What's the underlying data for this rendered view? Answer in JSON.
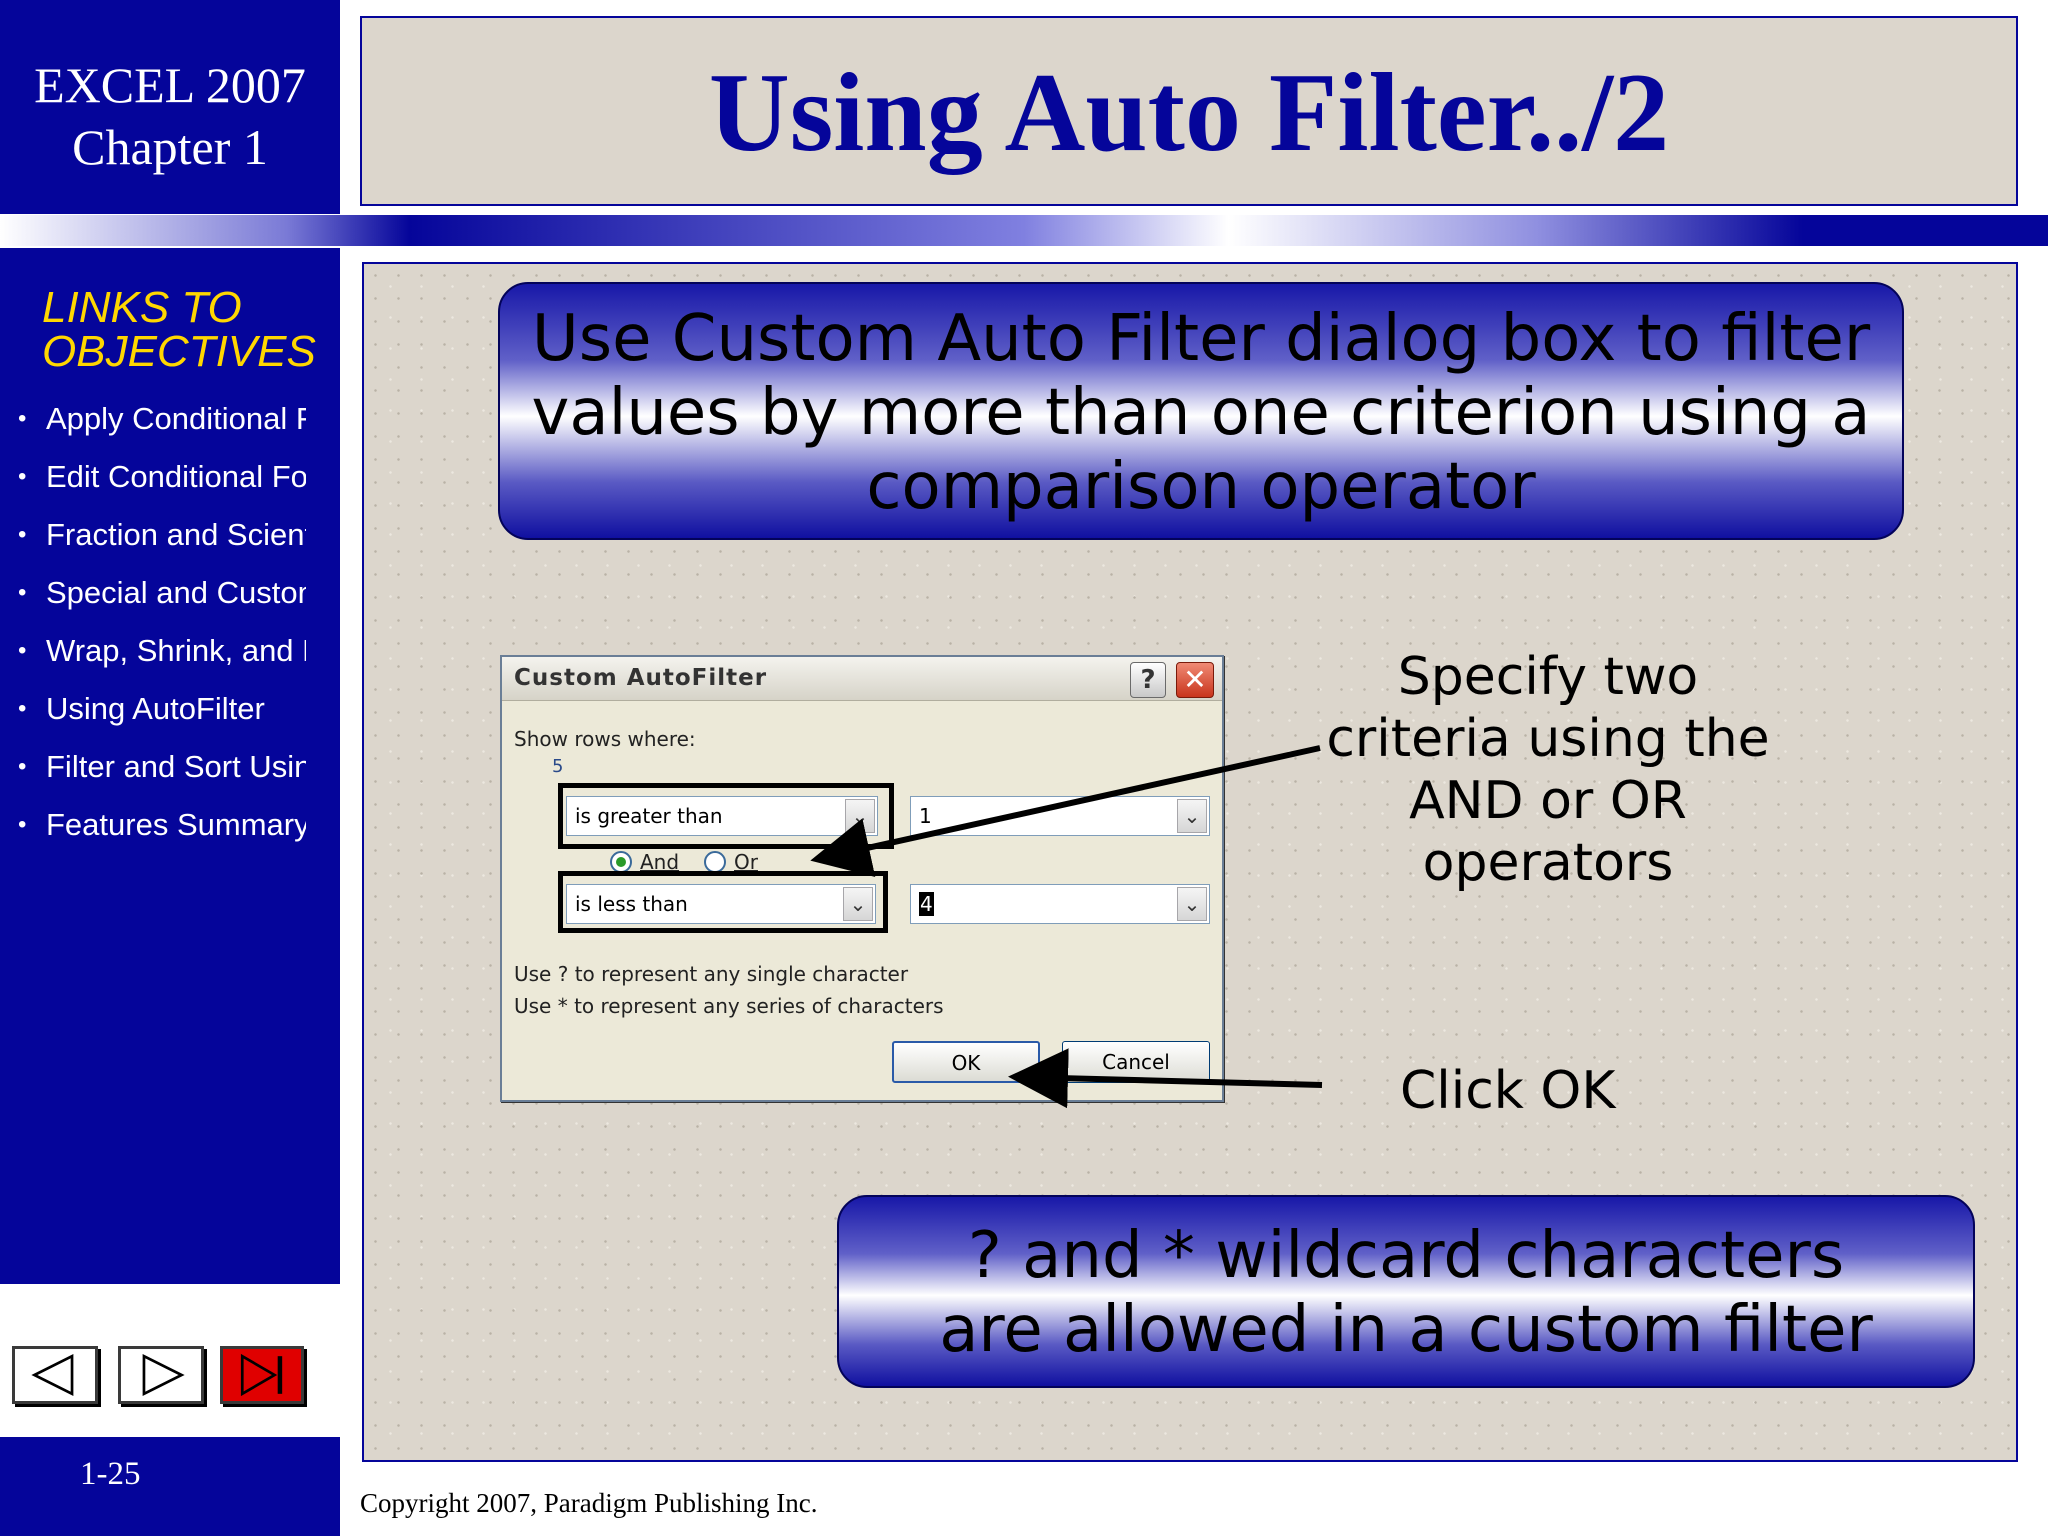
{
  "sidebar": {
    "title_line1": "EXCEL 2007",
    "title_line2": "Chapter 1",
    "links_heading_line1": "LINKS TO",
    "links_heading_line2": "OBJECTIVES",
    "links": [
      "Apply Conditional Fo",
      "Edit Conditional Forn",
      "Fraction and Scientifi",
      "Special and Custom",
      "Wrap, Shrink, and M",
      "Using AutoFilter",
      "Filter and Sort Using",
      "Features Summary"
    ],
    "nav": {
      "back": "BACK",
      "next": "NEXT",
      "end": "END"
    },
    "page_number": "1-25",
    "colors": {
      "sidebar_bg": "#05059a",
      "links_heading": "#ffd700",
      "end_button": "#e00000"
    }
  },
  "slide": {
    "title": "Using Auto Filter../2",
    "banner_top": [
      "Use Custom Auto Filter dialog box to filter",
      "values by more than one criterion using a",
      "comparison operator"
    ],
    "callout_criteria": [
      "Specify two",
      "criteria using the",
      "AND or OR",
      "operators"
    ],
    "callout_ok": "Click OK",
    "banner_bottom": [
      "? and * wildcard characters",
      "are allowed in a custom filter"
    ],
    "copyright": "Copyright 2007, Paradigm Publishing Inc."
  },
  "dialog": {
    "title": "Custom AutoFilter",
    "help_glyph": "?",
    "close_glyph": "✕",
    "show_rows_label": "Show rows where:",
    "field_name": "5",
    "row1": {
      "operator": "is greater than",
      "value": "1"
    },
    "logic": {
      "and_label": "And",
      "or_label": "Or",
      "selected": "And"
    },
    "row2": {
      "operator": "is less than",
      "value": "4"
    },
    "hint1": "Use ? to represent any single character",
    "hint2": "Use * to represent any series of characters",
    "ok_label": "OK",
    "cancel_label": "Cancel",
    "dropdown_glyph": "⌄"
  }
}
